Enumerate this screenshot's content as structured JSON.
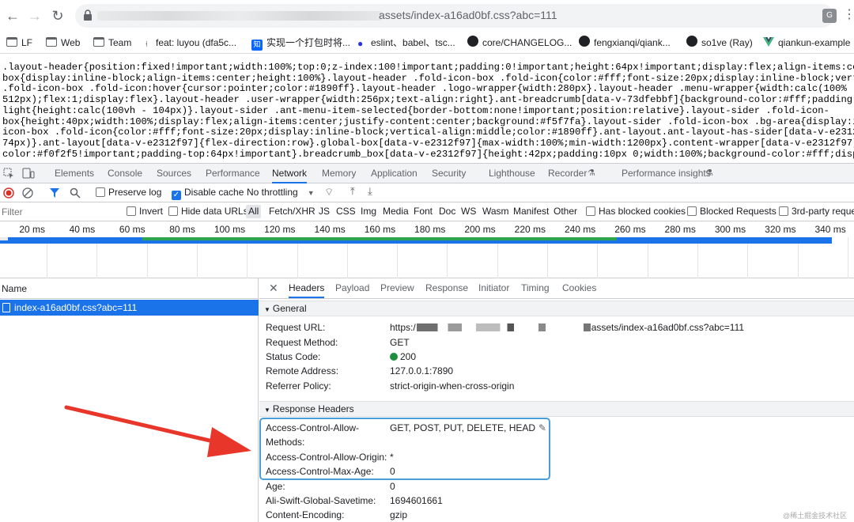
{
  "browser": {
    "url_visible": "assets/index-a16ad0bf.css?abc=111",
    "nav_back": "←",
    "nav_forward": "→",
    "nav_reload": "↻",
    "translate_label": "G"
  },
  "bookmarks": [
    {
      "label": "LF",
      "icon": "folder-icon"
    },
    {
      "label": "Web",
      "icon": "folder-icon"
    },
    {
      "label": "Team",
      "icon": "folder-icon"
    },
    {
      "label": "feat: luyou (dfa5c...",
      "icon": "commit-icon"
    },
    {
      "label": "实现一个打包时将...",
      "icon": "zhihu-icon",
      "icon_text": "知"
    },
    {
      "label": "eslint、babel、tsc...",
      "icon": "baidu-paw-icon"
    },
    {
      "label": "core/CHANGELOG...",
      "icon": "github-icon"
    },
    {
      "label": "fengxianqi/qiank...",
      "icon": "github-icon"
    },
    {
      "label": "so1ve (Ray)",
      "icon": "github-icon"
    },
    {
      "label": "qiankun-example",
      "icon": "vue-icon"
    }
  ],
  "css_lines": [
    ".layout-header{position:fixed!important;width:100%;top:0;z-index:100!important;padding:0!important;height:64px!important;display:flex;align-items:center",
    "box{display:inline-block;align-items:center;height:100%}.layout-header .fold-icon-box .fold-icon{color:#fff;font-size:20px;display:inline-block;vertica",
    ".fold-icon-box .fold-icon:hover{cursor:pointer;color:#1890ff}.layout-header .logo-wrapper{width:280px}.layout-header .menu-wrapper{width:calc(100% -",
    "512px);flex:1;display:flex}.layout-header .user-wrapper{width:256px;text-align:right}.ant-breadcrumb[data-v-73dfebbf]{background-color:#fff;padding:10p",
    "light{height:calc(100vh - 104px)}.layout-sider .ant-menu-item-selected{border-bottom:none!important;position:relative}.layout-sider .fold-icon-",
    "box{height:40px;width:100%;display:flex;align-items:center;justify-content:center;background:#f5f7fa}.layout-sider .fold-icon-box .bg-area{display:inlin",
    "icon-box .fold-icon{color:#fff;font-size:20px;display:inline-block;vertical-align:middle;color:#1890ff}.ant-layout.ant-layout-has-sider[data-v-e2312f",
    "74px)}.ant-layout[data-v-e2312f97]{flex-direction:row}.global-box[data-v-e2312f97]{max-width:100%;min-width:1200px}.content-wrapper[data-v-e2312f97]{ov",
    "color:#f0f2f5!important;padding-top:64px!important}.breadcrumb_box[data-v-e2312f97]{height:42px;padding:10px 0;width:100%;background-color:#fff;display"
  ],
  "devtools_tabs": [
    "Elements",
    "Console",
    "Sources",
    "Performance",
    "Network",
    "Memory",
    "Application",
    "Security",
    "Lighthouse",
    "Recorder",
    "Performance insights"
  ],
  "active_devtools_tab": "Network",
  "toolbar": {
    "preserve_log": "Preserve log",
    "preserve_log_checked": false,
    "disable_cache": "Disable cache",
    "disable_cache_checked": true,
    "throttling": "No throttling"
  },
  "filter": {
    "placeholder": "Filter",
    "invert": "Invert",
    "hide_data_urls": "Hide data URLs",
    "types": [
      "All",
      "Fetch/XHR",
      "JS",
      "CSS",
      "Img",
      "Media",
      "Font",
      "Doc",
      "WS",
      "Wasm",
      "Manifest",
      "Other"
    ],
    "active_type": "All",
    "has_blocked_cookies": "Has blocked cookies",
    "blocked_requests": "Blocked Requests",
    "third_party": "3rd-party reques"
  },
  "timeline_labels": [
    "20 ms",
    "40 ms",
    "60 ms",
    "80 ms",
    "100 ms",
    "120 ms",
    "140 ms",
    "160 ms",
    "180 ms",
    "200 ms",
    "220 ms",
    "240 ms",
    "260 ms",
    "280 ms",
    "300 ms",
    "320 ms",
    "340 ms"
  ],
  "name_panel": {
    "header": "Name",
    "rows": [
      "index-a16ad0bf.css?abc=111"
    ]
  },
  "detail_tabs": [
    "Headers",
    "Payload",
    "Preview",
    "Response",
    "Initiator",
    "Timing",
    "Cookies"
  ],
  "active_detail_tab": "Headers",
  "close_label": "✕",
  "general": {
    "title": "General",
    "rows": [
      {
        "key": "Request URL:",
        "value": "assets/index-a16ad0bf.css?abc=111",
        "prefix": "https:/"
      },
      {
        "key": "Request Method:",
        "value": "GET"
      },
      {
        "key": "Status Code:",
        "value": "200",
        "status_color": "#1e8e3e"
      },
      {
        "key": "Remote Address:",
        "value": "127.0.0.1:7890"
      },
      {
        "key": "Referrer Policy:",
        "value": "strict-origin-when-cross-origin"
      }
    ]
  },
  "response_headers": {
    "title": "Response Headers",
    "rows": [
      {
        "key": "Access-Control-Allow-",
        "key2": "Methods:",
        "value": "GET, POST, PUT, DELETE, HEAD"
      },
      {
        "key": "Access-Control-Allow-Origin:",
        "value": "*"
      },
      {
        "key": "Access-Control-Max-Age:",
        "value": "0"
      },
      {
        "key": "Age:",
        "value": "0"
      },
      {
        "key": "Ali-Swift-Global-Savetime:",
        "value": "1694601661"
      },
      {
        "key": "Content-Encoding:",
        "value": "gzip"
      }
    ]
  },
  "annotation": {
    "highlight_color": "#4a9fd8",
    "arrow_color": "#e8372a"
  },
  "watermark": "@稀土掘金技术社区"
}
